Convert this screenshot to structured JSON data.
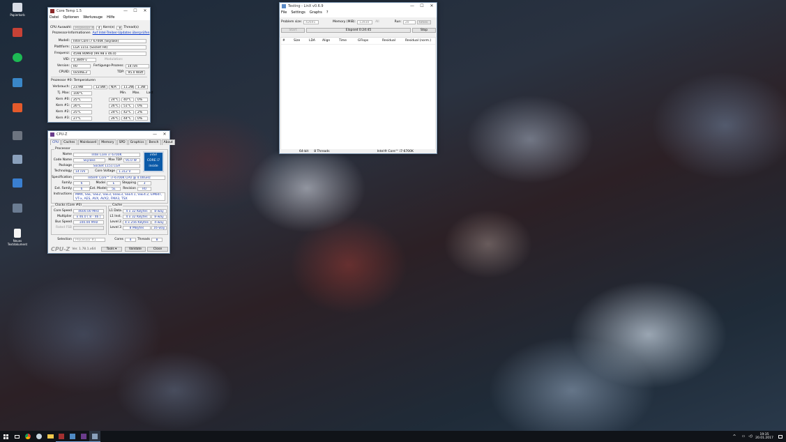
{
  "desktop_icons": [
    {
      "label": "Papierkorb",
      "color": "#d8dde6"
    },
    {
      "label": "",
      "color": "#c74236"
    },
    {
      "label": "",
      "color": "#1db954"
    },
    {
      "label": "",
      "color": "#3a87c8"
    },
    {
      "label": "",
      "color": "#d0a060"
    },
    {
      "label": "",
      "color": "#e45a2b"
    },
    {
      "label": "",
      "color": "#6d7480"
    },
    {
      "label": "",
      "color": "#8aa0bb"
    },
    {
      "label": "",
      "color": "#d83b01"
    },
    {
      "label": "",
      "color": "#6b7c92"
    },
    {
      "label": "Neues Textdokument",
      "color": "#f5f5f5"
    }
  ],
  "coretemp": {
    "title": "Core Temp 1.5",
    "menu": [
      "Datei",
      "Optionen",
      "Werkzeuge",
      "Hilfe"
    ],
    "cpu_select_label": "CPU Auswahl:",
    "cpu_select_value": "Prozessor #0",
    "cores": "4",
    "cores_label": "Kern(e)",
    "threads": "8",
    "threads_label": "Thread(s)",
    "info_label": "Prozessor-Informationen",
    "update_link": "Auf Intel-Treiber-Updates überprüfen",
    "model_label": "Modell:",
    "model": "Intel Core i7 6700K (Skylake)",
    "platform_label": "Plattform:",
    "platform": "LGA 1151 (Socket H4)",
    "freq_label": "Frequenz:",
    "freq": "4598.90MHz (99.98 x 46.0)",
    "vid_label": "VID:",
    "vid": "1.3849 v",
    "modulation": "Modulation:",
    "version_label": "Version:",
    "version": "R0",
    "process_label": "Fertigungs-Prozess:",
    "process": "14 nm",
    "cpuid_label": "CPUID:",
    "cpuid": "0x506E3",
    "tdp_label": "TDP:",
    "tdp": "95.0 Watt",
    "temp_header": "Prozessor #0: Temperaturen",
    "power_label": "Verbrauch:",
    "power": [
      "23.9W",
      "12.8W",
      "N/A",
      "11.2W",
      "1.3W"
    ],
    "tjmax_label": "Tj. Max:",
    "tjmax": "100°C",
    "col_min": "Min.",
    "col_max": "Max.",
    "col_load": "Last",
    "cores_rows": [
      {
        "name": "Kern #0:",
        "temp": "25°C",
        "min": "24°C",
        "max": "40°C",
        "load": "0%"
      },
      {
        "name": "Kern #1:",
        "temp": "26°C",
        "min": "26°C",
        "max": "51°C",
        "load": "0%"
      },
      {
        "name": "Kern #2:",
        "temp": "25°C",
        "min": "24°C",
        "max": "42°C",
        "load": "2%"
      },
      {
        "name": "Kern #3:",
        "temp": "27°C",
        "min": "26°C",
        "max": "44°C",
        "load": "0%"
      }
    ]
  },
  "cpuz": {
    "title": "CPU-Z",
    "tabs": [
      "CPU",
      "Caches",
      "Mainboard",
      "Memory",
      "SPD",
      "Graphics",
      "Bench",
      "About"
    ],
    "processor_group": "Processor",
    "name_label": "Name",
    "name": "Intel Core i7 6700K",
    "codename_label": "Code Name",
    "codename": "Skylake",
    "maxtdp_label": "Max TDP",
    "maxtdp": "95.0 W",
    "package_label": "Package",
    "package": "Socket 1151 LGA",
    "tech_label": "Technology",
    "tech": "14 nm",
    "corevolt_label": "Core Voltage",
    "corevolt": "1.312 V",
    "spec_label": "Specification",
    "spec": "Intel® Core™ i7-6700K CPU @ 4.00GHz",
    "family_label": "Family",
    "family": "6",
    "model_label": "Model",
    "model": "E",
    "stepping_label": "Stepping",
    "stepping": "3",
    "extfam_label": "Ext. Family",
    "extfam": "6",
    "extmodel_label": "Ext. Model",
    "extmodel": "5E",
    "revision_label": "Revision",
    "revision": "R0",
    "instr_label": "Instructions",
    "instr": "MMX, SSE, SSE2, SSE3, SSSE3, SSE4.1, SSE4.2, EM64T, VT-x, AES, AVX, AVX2, FMA3, TSX",
    "intel_badge_top": "intel",
    "intel_badge_mid": "CORE i7",
    "intel_badge_bot": "inside",
    "clocks_group": "Clocks (Core #0)",
    "cache_group": "Cache",
    "corespeed_label": "Core Speed",
    "corespeed": "4600.00 MHz",
    "mult_label": "Multiplier",
    "mult": "x 46.0 ( 8 - 46 )",
    "bus_label": "Bus Speed",
    "bus": "100.00 MHz",
    "fsb_label": "Rated FSB",
    "l1d_label": "L1 Data",
    "l1d": "4 x 32 KBytes",
    "l1d_way": "8-way",
    "l1i_label": "L1 Inst.",
    "l1i": "4 x 32 KBytes",
    "l1i_way": "8-way",
    "l2_label": "Level 2",
    "l2": "4 x 256 KBytes",
    "l2_way": "4-way",
    "l3_label": "Level 3",
    "l3": "8 MBytes",
    "l3_way": "16-way",
    "selection_label": "Selection",
    "selection": "Processor #1",
    "cores_label": "Cores",
    "cores": "4",
    "threads_label": "Threads",
    "threads": "8",
    "brand": "CPU-Z",
    "version": "Ver. 1.78.1.x64",
    "tools_label": "Tools",
    "validate_label": "Validate",
    "close_label": "Close"
  },
  "linx": {
    "title": "Testing - LinX v0.6.9",
    "menu": [
      "File",
      "Settings",
      "Graphs",
      "?"
    ],
    "problem_label": "Problem size:",
    "problem": "42691",
    "memory_label": "Memory (MiB):",
    "memory": "13930",
    "all_label": "All",
    "run_label": "Run:",
    "run": "20",
    "run_unit": "times",
    "start_label": "Start",
    "elapsed": "Elapsed 0:24:45",
    "stop_label": "Stop",
    "columns": [
      "#",
      "Size",
      "LDA",
      "Align",
      "Time",
      "GFlops",
      "Residual",
      "Residual (norm.)"
    ],
    "status_bits": "64-bit",
    "status_threads": "8 Threads",
    "status_cpu": "Intel® Core™ i7-6700K"
  },
  "taskbar": {
    "clock": "19:35",
    "date": "20.01.2017",
    "tray_lang": "DEU"
  }
}
